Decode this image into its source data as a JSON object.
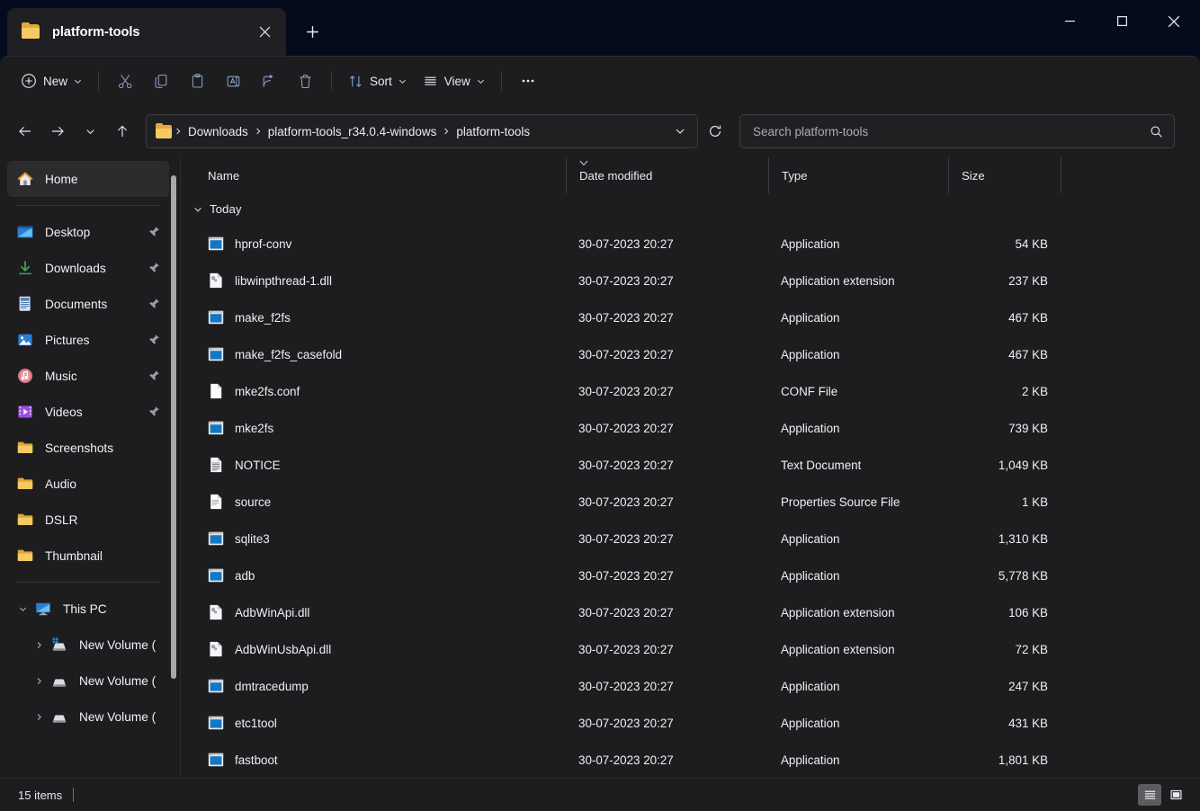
{
  "window": {
    "tab_title": "platform-tools",
    "tab_icon": "folder-icon",
    "close_tab_icon": "close-icon",
    "new_tab_icon": "plus-icon",
    "minimize_icon": "minimize-icon",
    "maximize_icon": "maximize-icon",
    "close_icon": "close-icon"
  },
  "toolbar": {
    "new_label": "New",
    "sort_label": "Sort",
    "view_label": "View",
    "cut_icon": "scissors-icon",
    "copy_icon": "copy-icon",
    "paste_icon": "paste-icon",
    "rename_icon": "rename-icon",
    "share_icon": "share-icon",
    "delete_icon": "trash-icon",
    "sort_icon": "sort-arrows-icon",
    "view_icon": "view-lines-icon",
    "more_icon": "ellipsis-icon"
  },
  "address": {
    "back_icon": "arrow-left-icon",
    "forward_icon": "arrow-right-icon",
    "recent_icon": "chevron-down-icon",
    "up_icon": "arrow-up-icon",
    "folder_icon": "folder-icon",
    "crumbs": [
      "Downloads",
      "platform-tools_r34.0.4-windows",
      "platform-tools"
    ],
    "dropdown_icon": "chevron-down-icon",
    "refresh_icon": "refresh-icon"
  },
  "search": {
    "placeholder": "Search platform-tools",
    "value": "",
    "icon": "search-icon"
  },
  "sidebar": {
    "quick_access": [
      {
        "label": "Home",
        "icon": "home-icon",
        "selected": true,
        "pinned": false
      },
      {
        "label": "Desktop",
        "icon": "desktop-icon",
        "selected": false,
        "pinned": true
      },
      {
        "label": "Downloads",
        "icon": "download-icon",
        "selected": false,
        "pinned": true
      },
      {
        "label": "Documents",
        "icon": "documents-icon",
        "selected": false,
        "pinned": true
      },
      {
        "label": "Pictures",
        "icon": "pictures-icon",
        "selected": false,
        "pinned": true
      },
      {
        "label": "Music",
        "icon": "music-icon",
        "selected": false,
        "pinned": true
      },
      {
        "label": "Videos",
        "icon": "videos-icon",
        "selected": false,
        "pinned": true
      },
      {
        "label": "Screenshots",
        "icon": "folder-icon",
        "selected": false,
        "pinned": false
      },
      {
        "label": "Audio",
        "icon": "folder-icon",
        "selected": false,
        "pinned": false
      },
      {
        "label": "DSLR",
        "icon": "folder-icon",
        "selected": false,
        "pinned": false
      },
      {
        "label": "Thumbnail",
        "icon": "folder-icon",
        "selected": false,
        "pinned": false
      }
    ],
    "this_pc": {
      "label": "This PC",
      "icon": "this-pc-icon",
      "expanded": true,
      "drives": [
        {
          "label": "New Volume (",
          "icon": "system-drive-icon"
        },
        {
          "label": "New Volume (",
          "icon": "drive-icon"
        },
        {
          "label": "New Volume (",
          "icon": "drive-icon"
        }
      ]
    }
  },
  "file_list": {
    "columns": [
      "Name",
      "Date modified",
      "Type",
      "Size"
    ],
    "sort_column": "Date modified",
    "group_label": "Today",
    "rows": [
      {
        "name": "hprof-conv",
        "date": "30-07-2023 20:27",
        "type": "Application",
        "size": "54 KB",
        "icon": "application-icon"
      },
      {
        "name": "libwinpthread-1.dll",
        "date": "30-07-2023 20:27",
        "type": "Application extension",
        "size": "237 KB",
        "icon": "dll-icon"
      },
      {
        "name": "make_f2fs",
        "date": "30-07-2023 20:27",
        "type": "Application",
        "size": "467 KB",
        "icon": "application-icon"
      },
      {
        "name": "make_f2fs_casefold",
        "date": "30-07-2023 20:27",
        "type": "Application",
        "size": "467 KB",
        "icon": "application-icon"
      },
      {
        "name": "mke2fs.conf",
        "date": "30-07-2023 20:27",
        "type": "CONF File",
        "size": "2 KB",
        "icon": "blank-file-icon"
      },
      {
        "name": "mke2fs",
        "date": "30-07-2023 20:27",
        "type": "Application",
        "size": "739 KB",
        "icon": "application-icon"
      },
      {
        "name": "NOTICE",
        "date": "30-07-2023 20:27",
        "type": "Text Document",
        "size": "1,049 KB",
        "icon": "text-document-icon"
      },
      {
        "name": "source",
        "date": "30-07-2023 20:27",
        "type": "Properties Source File",
        "size": "1 KB",
        "icon": "properties-source-icon"
      },
      {
        "name": "sqlite3",
        "date": "30-07-2023 20:27",
        "type": "Application",
        "size": "1,310 KB",
        "icon": "application-icon"
      },
      {
        "name": "adb",
        "date": "30-07-2023 20:27",
        "type": "Application",
        "size": "5,778 KB",
        "icon": "application-icon"
      },
      {
        "name": "AdbWinApi.dll",
        "date": "30-07-2023 20:27",
        "type": "Application extension",
        "size": "106 KB",
        "icon": "dll-icon"
      },
      {
        "name": "AdbWinUsbApi.dll",
        "date": "30-07-2023 20:27",
        "type": "Application extension",
        "size": "72 KB",
        "icon": "dll-icon"
      },
      {
        "name": "dmtracedump",
        "date": "30-07-2023 20:27",
        "type": "Application",
        "size": "247 KB",
        "icon": "application-icon"
      },
      {
        "name": "etc1tool",
        "date": "30-07-2023 20:27",
        "type": "Application",
        "size": "431 KB",
        "icon": "application-icon"
      },
      {
        "name": "fastboot",
        "date": "30-07-2023 20:27",
        "type": "Application",
        "size": "1,801 KB",
        "icon": "application-icon"
      }
    ]
  },
  "status": {
    "item_count": "15 items",
    "details_view_icon": "details-view-icon",
    "large_icons_view_icon": "large-icons-view-icon",
    "active_view": "details"
  },
  "colors": {
    "titlebar_bg": "#030b1c",
    "shell_bg": "#1d1d1f",
    "tab_bg": "#202024",
    "accent_folder": "#f6c963",
    "text_primary": "#eef0f4",
    "selected_bg": "#2c2c2e"
  }
}
